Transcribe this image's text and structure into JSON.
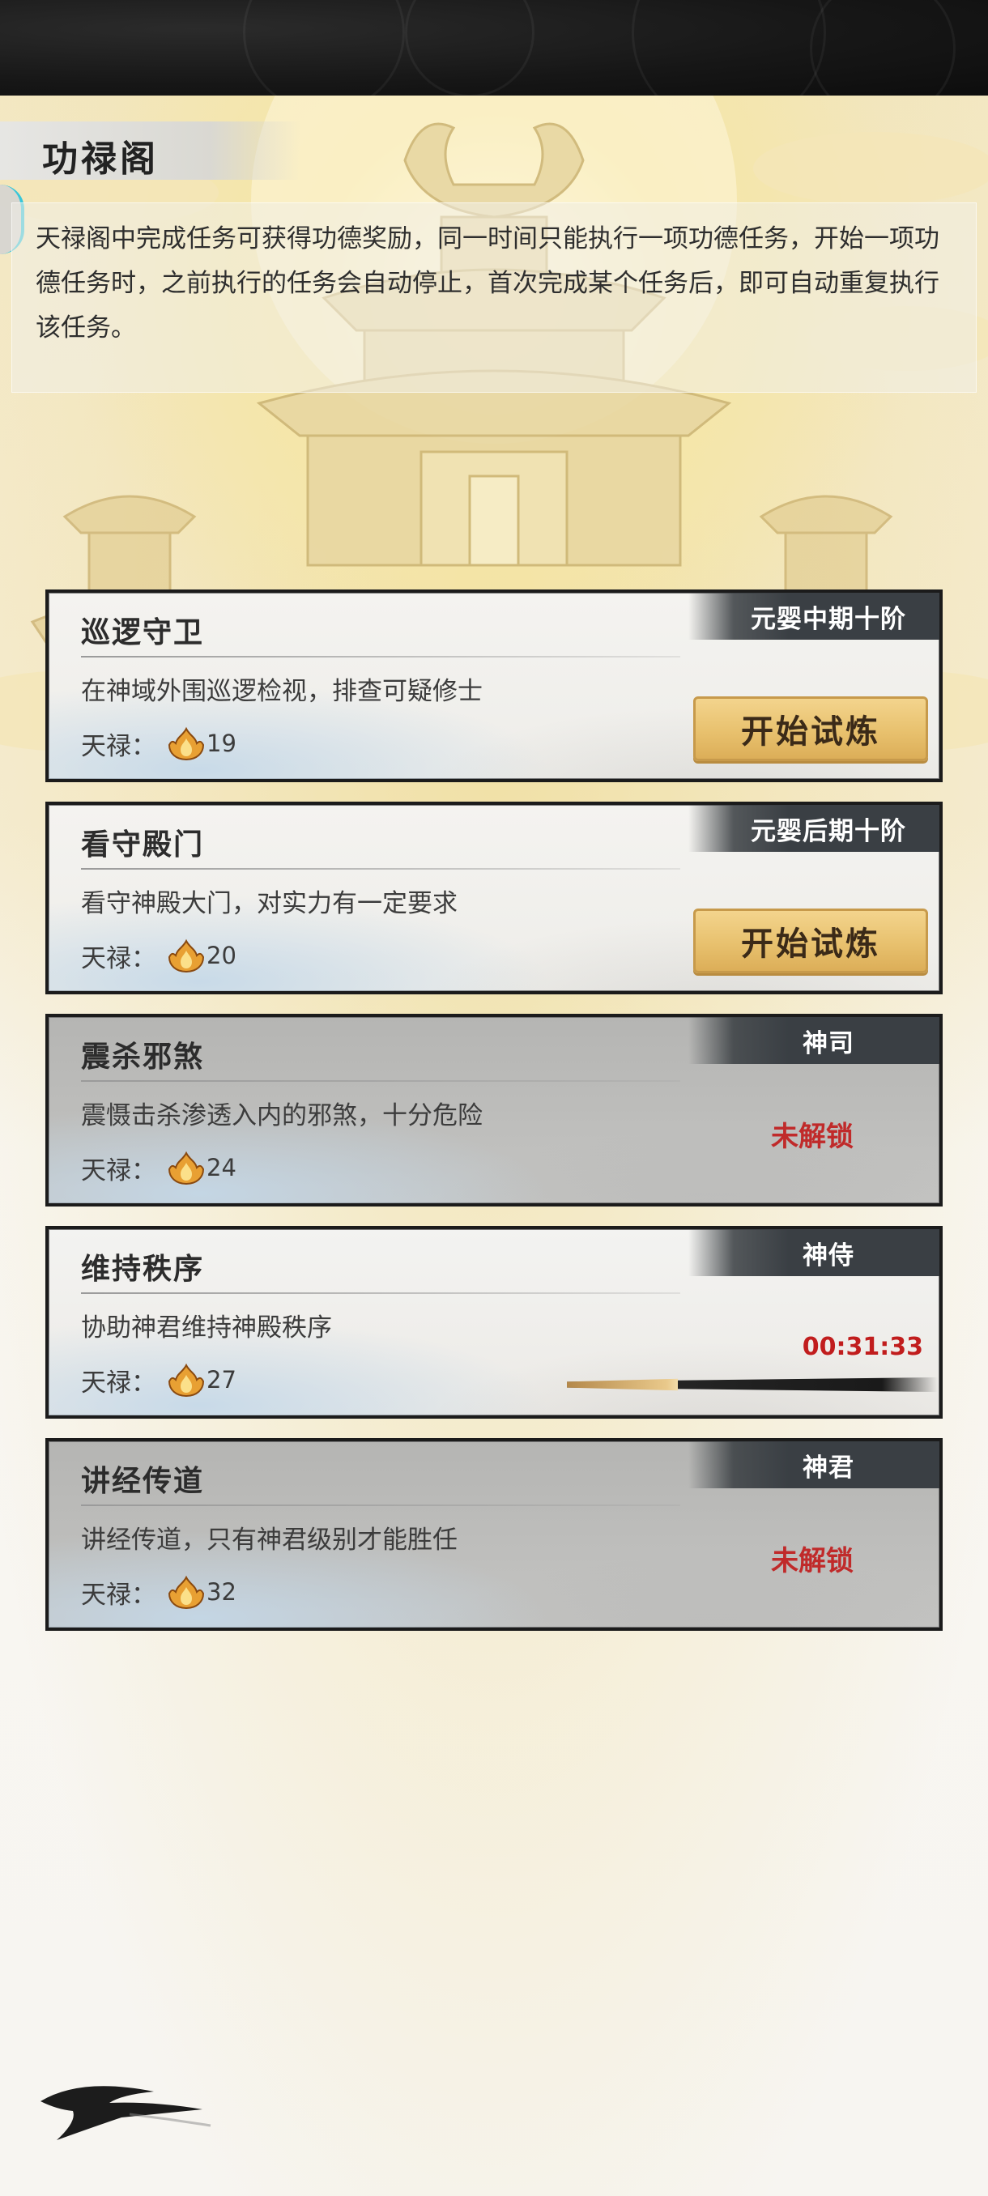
{
  "page": {
    "title": "功禄阁"
  },
  "info": {
    "description": "天禄阁中完成任务可获得功德奖励，同一时间只能执行一项功德任务，开始一项功德任务时，之前执行的任务会自动停止，首次完成某个任务后，即可自动重复执行该任务。"
  },
  "reward_label": "天禄：",
  "tasks": [
    {
      "title": "巡逻守卫",
      "desc": "在神域外围巡逻检视，排查可疑修士",
      "realm": "元婴中期十阶",
      "reward": "19",
      "status": "available",
      "action": "开始试炼"
    },
    {
      "title": "看守殿门",
      "desc": "看守神殿大门，对实力有一定要求",
      "realm": "元婴后期十阶",
      "reward": "20",
      "status": "available",
      "action": "开始试炼"
    },
    {
      "title": "震杀邪煞",
      "desc": "震慑击杀渗透入内的邪煞，十分危险",
      "realm": "神司",
      "reward": "24",
      "status": "locked",
      "locked_text": "未解锁"
    },
    {
      "title": "维持秩序",
      "desc": "协助神君维持神殿秩序",
      "realm": "神侍",
      "reward": "27",
      "status": "in_progress",
      "timer": "00:31:33",
      "progress": 0.3
    },
    {
      "title": "讲经传道",
      "desc": "讲经传道，只有神君级别才能胜任",
      "realm": "神君",
      "reward": "32",
      "status": "locked",
      "locked_text": "未解锁"
    }
  ],
  "icons": {
    "reward": "flame-currency-icon",
    "corner": "brush-stroke-icon"
  },
  "colors": {
    "locked": "#c02a2a",
    "button_gold": "#e8c16e",
    "timer": "#c11d1d"
  }
}
